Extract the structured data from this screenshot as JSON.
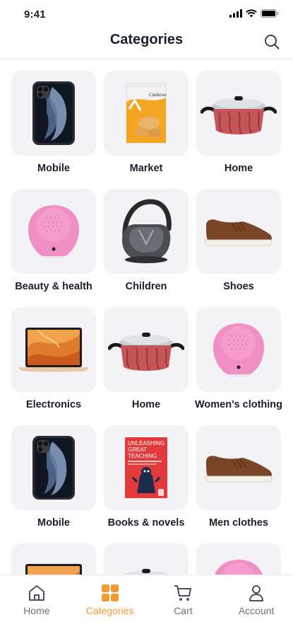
{
  "status": {
    "time": "9:41"
  },
  "header": {
    "title": "Categories"
  },
  "categories": [
    {
      "label": "Mobile",
      "icon": "phone-image"
    },
    {
      "label": "Market",
      "icon": "snack-bag-image"
    },
    {
      "label": "Home",
      "icon": "cooking-pot-image"
    },
    {
      "label": "Beauty & health",
      "icon": "face-cleanser-image"
    },
    {
      "label": "Children",
      "icon": "baby-car-seat-image"
    },
    {
      "label": "Shoes",
      "icon": "shoe-image"
    },
    {
      "label": "Electronics",
      "icon": "laptop-image"
    },
    {
      "label": "Home",
      "icon": "cooking-pot-image"
    },
    {
      "label": "Women's clothing",
      "icon": "face-cleanser-image"
    },
    {
      "label": "Mobile",
      "icon": "phone-image"
    },
    {
      "label": "Books & novels",
      "icon": "book-image"
    },
    {
      "label": "Men clothes",
      "icon": "shoe-image"
    },
    {
      "label": "",
      "icon": "laptop-image"
    },
    {
      "label": "",
      "icon": "cooking-pot-image"
    },
    {
      "label": "",
      "icon": "face-cleanser-image"
    }
  ],
  "product_text": {
    "snack_brand": "Cashews",
    "book_title_lines": [
      "UNLEASHING",
      "GREAT",
      "TEACHING"
    ]
  },
  "tabbar": {
    "home": "Home",
    "categories": "Categories",
    "cart": "Cart",
    "account": "Account",
    "active": "categories"
  },
  "colors": {
    "accent": "#f39a38",
    "text": "#1b1f2e",
    "muted": "#6d7180",
    "tile": "#f3f3f6"
  }
}
